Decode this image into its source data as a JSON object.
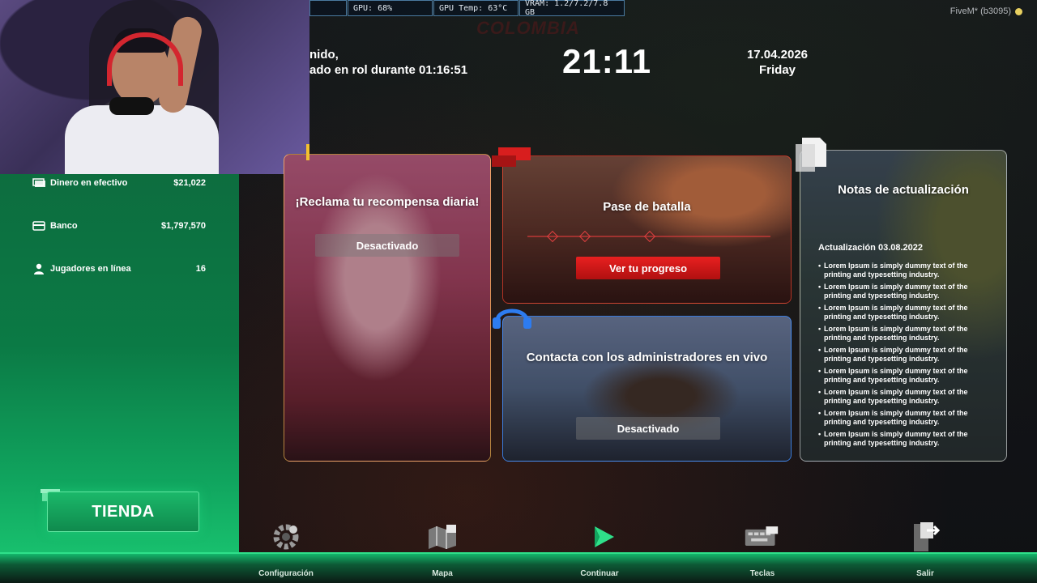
{
  "hud": {
    "gpu": "GPU: 68%",
    "gpu_temp": "GPU Temp: 63°C",
    "vram": "VRAM: 1.2/7.2/7.8 GB"
  },
  "window_title": "FiveM* (b3095)",
  "greeting": {
    "line1": "nido,",
    "line2": "ado en rol durante 01:16:51"
  },
  "clock": "21:11",
  "date": {
    "day": "17.04.2026",
    "weekday": "Friday"
  },
  "logo_text": "COLOMBIA",
  "sidebar": {
    "stats": [
      {
        "icon": "cash-icon",
        "label": "Dinero en efectivo",
        "value": "$21,022"
      },
      {
        "icon": "card-icon",
        "label": "Banco",
        "value": "$1,797,570"
      },
      {
        "icon": "user-icon",
        "label": "Jugadores en línea",
        "value": "16"
      }
    ],
    "shop_label": "TIENDA"
  },
  "cards": {
    "daily": {
      "title": "¡Reclama tu recompensa diaria!",
      "button": "Desactivado"
    },
    "battle_pass": {
      "title": "Pase de batalla",
      "button": "Ver tu progreso"
    },
    "contact": {
      "title": "Contacta con los administradores en vivo",
      "button": "Desactivado"
    },
    "notes": {
      "title": "Notas de actualización",
      "subtitle": "Actualización 03.08.2022",
      "items": [
        "Lorem Ipsum is simply dummy text of the printing and typesetting industry.",
        "Lorem Ipsum is simply dummy text of the printing and typesetting industry.",
        "Lorem Ipsum is simply dummy text of the printing and typesetting industry.",
        "Lorem Ipsum is simply dummy text of the printing and typesetting industry.",
        "Lorem Ipsum is simply dummy text of the printing and typesetting industry.",
        "Lorem Ipsum is simply dummy text of the printing and typesetting industry.",
        "Lorem Ipsum is simply dummy text of the printing and typesetting industry.",
        "Lorem Ipsum is simply dummy text of the printing and typesetting industry.",
        "Lorem Ipsum is simply dummy text of the printing and typesetting industry."
      ]
    }
  },
  "nav": [
    {
      "icon": "gear-icon",
      "label": "Configuración"
    },
    {
      "icon": "map-icon",
      "label": "Mapa"
    },
    {
      "icon": "play-icon",
      "label": "Continuar"
    },
    {
      "icon": "keyboard-icon",
      "label": "Teclas"
    },
    {
      "icon": "exit-icon",
      "label": "Salir"
    }
  ],
  "colors": {
    "accent_green": "#10a45e",
    "accent_red": "#e82020",
    "contact_blue": "#3c8cff"
  }
}
